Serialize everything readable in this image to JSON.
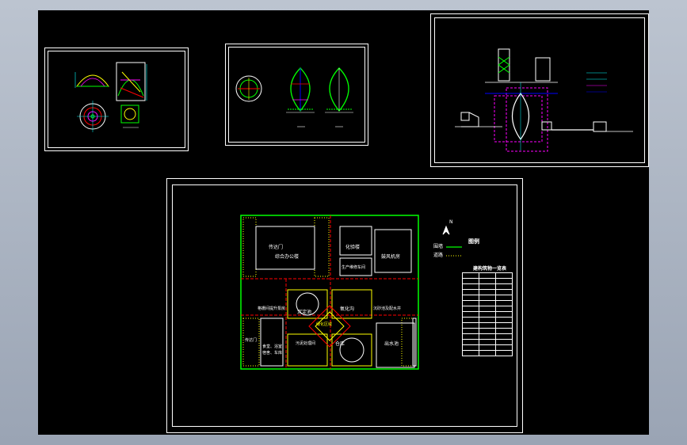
{
  "drawing": {
    "background": "#000000",
    "line_colors": {
      "outline": "#ffffff",
      "green": "#00ff00",
      "red": "#ff0000",
      "magenta": "#ff00ff",
      "yellow": "#ffff00",
      "blue": "#3030ff",
      "cyan": "#00ffff"
    }
  },
  "sheet4": {
    "legend_title": "图例",
    "north_label": "N",
    "legend_items": [
      "围墙",
      "道路"
    ],
    "table_title": "建构筑物一览表",
    "zones": {
      "gate_top_left": "传达门",
      "office_building": "综合办公楼",
      "lab": "化验楼",
      "workshop": "生产维修车间",
      "pump_room": "鼓风机房",
      "sludge": "污泥处理间",
      "tank_left": "沉淀池",
      "tank_right": "氧化沟",
      "gate_bottom_left": "传达门",
      "storage": "仓库",
      "outlet": "出水池",
      "rest_left": "食堂、浴室",
      "rest_left2": "宿舍、车库",
      "green_area": "绿化区域",
      "mid_label_left": "格栅间提升泵房",
      "mid_label_right": "沉砂池及配水井"
    }
  }
}
